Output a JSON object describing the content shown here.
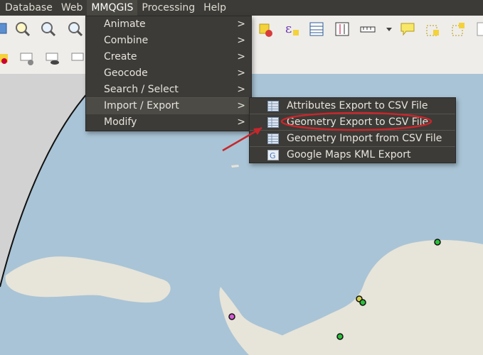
{
  "menubar": {
    "items": [
      {
        "label": "Database"
      },
      {
        "label": "Web"
      },
      {
        "label": "MMQGIS"
      },
      {
        "label": "Processing"
      },
      {
        "label": "Help"
      }
    ]
  },
  "mmqgis_menu": {
    "items": [
      {
        "label": "Animate"
      },
      {
        "label": "Combine"
      },
      {
        "label": "Create"
      },
      {
        "label": "Geocode"
      },
      {
        "label": "Search / Select"
      },
      {
        "label": "Import / Export"
      },
      {
        "label": "Modify"
      }
    ],
    "submenu_arrow": ">"
  },
  "import_export_submenu": {
    "items": [
      {
        "label": "Attributes Export to CSV File",
        "icon": "table-icon"
      },
      {
        "label": "Geometry Export to CSV File",
        "icon": "table-icon"
      },
      {
        "label": "Geometry Import from CSV File",
        "icon": "table-icon"
      },
      {
        "label": "Google Maps KML Export",
        "icon": "google-icon"
      }
    ]
  },
  "toolbar_icons": [
    "zoom-in-icon",
    "zoom-out-icon",
    "zoom-selection-icon",
    "select-features-icon",
    "expression-icon",
    "attribute-table-icon",
    "statistics-icon",
    "measure-icon",
    "annotation-icon",
    "label-icon"
  ],
  "colors": {
    "menu_bg": "#3c3b37",
    "menu_text": "#e8e4dc",
    "ocean": "#a9c4d6",
    "land": "#e7e4d9",
    "annotation_red": "#c8262b"
  }
}
